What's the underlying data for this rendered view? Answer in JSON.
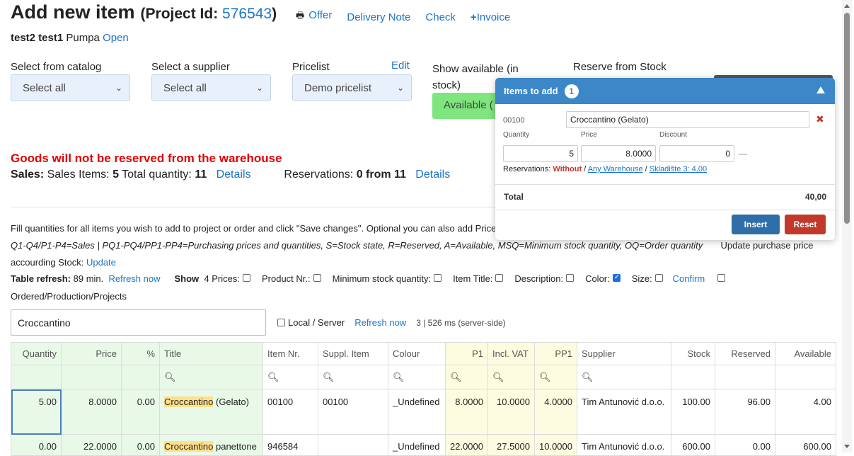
{
  "header": {
    "title": "Add new item",
    "project_prefix": "(Project Id: ",
    "project_id": "576543",
    "project_suffix": ")",
    "links": {
      "offer": "Offer",
      "delivery_note": "Delivery Note",
      "check": "Check",
      "invoice": "Invoice"
    }
  },
  "customer": {
    "name": "test2 test1",
    "company": "Pumpa",
    "status_link": "Open"
  },
  "filters": {
    "catalog_label": "Select from catalog",
    "catalog_value": "Select all",
    "supplier_label": "Select a supplier",
    "supplier_value": "Select all",
    "pricelist_label": "Pricelist",
    "pricelist_edit": "Edit",
    "pricelist_value": "Demo pricelist",
    "show_available_label_1": "Show available (in",
    "show_available_label_2": "stock)",
    "show_available_button": "Available (",
    "reserve_label": "Reserve from Stock"
  },
  "warning": "Goods will not be reserved from the warehouse",
  "sales": {
    "label": "Sales:",
    "items_text": "Sales Items:",
    "items_count": "5",
    "qty_text": "Total quantity:",
    "qty_value": "11",
    "details1": "Details",
    "res_text": "Reservations:",
    "res_value": "0 from 11",
    "details2": "Details"
  },
  "info": {
    "line1": "Fill quantities for all items you wish to add to project or order and click \"Save changes\". Optional you can also add Price",
    "line2_legend": "Q1-Q4/P1-P4=Sales | PQ1-PQ4/PP1-PP4=Purchasing prices and quantities, S=Stock state, R=Reserved, A=Available, MSQ=Minimum stock quantity, OQ=Order quantity",
    "line2_extra": "Update purchase price",
    "line3_text": "accourding Stock:",
    "line3_link": "Update",
    "table_refresh_label": "Table refresh:",
    "table_refresh_value": "89 min.",
    "refresh_now": "Refresh now",
    "show_label": "Show",
    "opt_4prices": "4 Prices:",
    "opt_product_nr": "Product Nr.:",
    "opt_min_stock": "Minimum stock quantity:",
    "opt_item_title": "Item Title:",
    "opt_description": "Description:",
    "opt_color": "Color:",
    "opt_size": "Size:",
    "confirm": "Confirm",
    "line5": "Ordered/Production/Projects"
  },
  "search": {
    "value": "Croccantino",
    "local_server": "Local / Server",
    "refresh_now": "Refresh now",
    "timing": "3 | 526 ms (server-side)"
  },
  "table": {
    "headers": [
      "Quantity",
      "Price",
      "%",
      "Title",
      "Item Nr.",
      "Suppl. Item",
      "Colour",
      "P1",
      "Incl. VAT",
      "PP1",
      "Supplier",
      "Stock",
      "Reserved",
      "Available"
    ],
    "rows": [
      {
        "qty": "5.00",
        "price": "8.0000",
        "pct": "0.00",
        "title_hl": "Croccantino",
        "title_rest": " (Gelato)",
        "item_nr": "00100",
        "suppl_item": "00100",
        "colour": "_Undefined",
        "p1": "8.0000",
        "vat": "10.0000",
        "pp1": "4.0000",
        "supplier": "Tim Antunović d.o.o.",
        "stock": "100.00",
        "reserved": "96.00",
        "available": "4.00"
      },
      {
        "qty": "0.00",
        "price": "22.0000",
        "pct": "0.00",
        "title_hl": "Croccantino",
        "title_rest": " panettone",
        "item_nr": "946584",
        "suppl_item": "",
        "colour": "_Undefined",
        "p1": "22.0000",
        "vat": "27.5000",
        "pp1": "10.0000",
        "supplier": "Tim Antunović d.o.o.",
        "stock": "600.00",
        "reserved": "0.00",
        "available": "600.00"
      }
    ]
  },
  "popup": {
    "title": "Items to add",
    "count": "1",
    "code": "00100",
    "name": "Croccantino (Gelato)",
    "quantity_label": "Quantity",
    "price_label": "Price",
    "discount_label": "Discount",
    "quantity": "5",
    "price": "8.0000",
    "discount": "0",
    "dash": "—",
    "res_label": "Reservations:",
    "res_without": "Without",
    "res_any": "Any Warehouse",
    "res_store": "Skladište 3: 4,00",
    "total_label": "Total",
    "total_value": "40,00",
    "insert": "Insert",
    "reset": "Reset"
  }
}
